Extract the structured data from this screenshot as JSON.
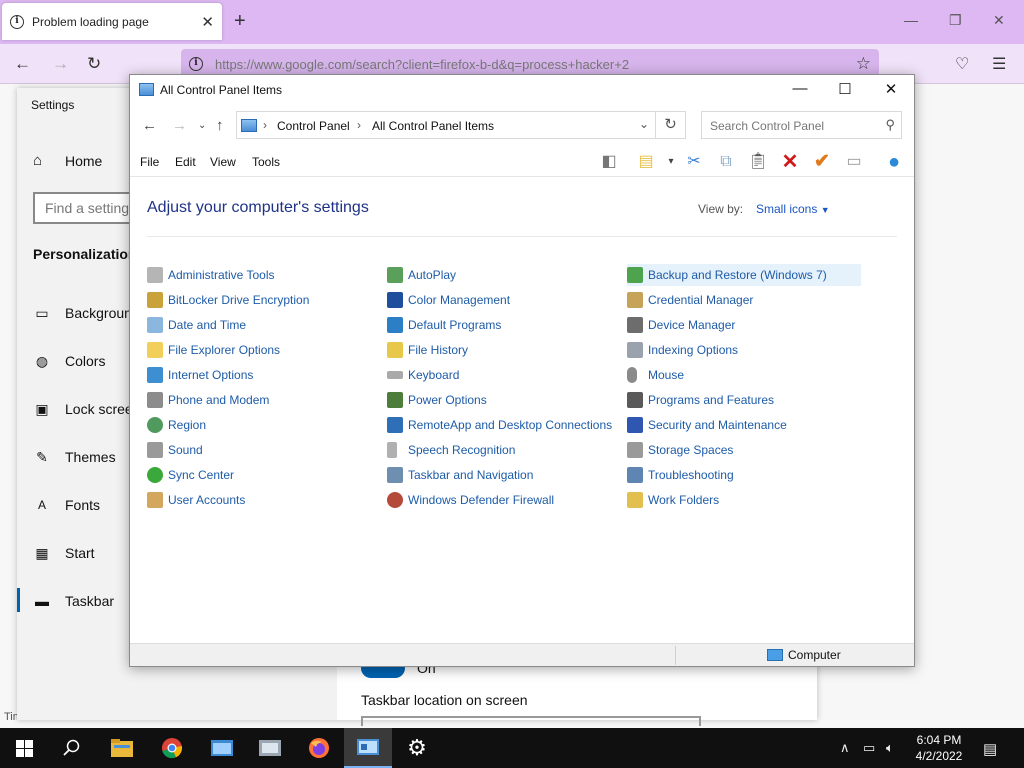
{
  "browser": {
    "tab_title": "Problem loading page",
    "url": "https://www.google.com/search?client=firefox-b-d&q=process+hacker+2",
    "page_status": "Timed Out"
  },
  "settings": {
    "title": "Settings",
    "home": "Home",
    "find_placeholder": "Find a setting",
    "section": "Personalization",
    "nav": [
      "Background",
      "Colors",
      "Lock screen",
      "Themes",
      "Fonts",
      "Start",
      "Taskbar"
    ],
    "active_nav": "Taskbar",
    "toggle_state": "On",
    "location_label": "Taskbar location on screen"
  },
  "control_panel": {
    "title": "All Control Panel Items",
    "breadcrumb": [
      "Control Panel",
      "All Control Panel Items"
    ],
    "search_placeholder": "Search Control Panel",
    "menu": [
      "File",
      "Edit",
      "View",
      "Tools"
    ],
    "heading": "Adjust your computer's settings",
    "view_by_label": "View by:",
    "view_by_value": "Small icons",
    "columns": [
      [
        "Administrative Tools",
        "BitLocker Drive Encryption",
        "Date and Time",
        "File Explorer Options",
        "Internet Options",
        "Phone and Modem",
        "Region",
        "Sound",
        "Sync Center",
        "User Accounts"
      ],
      [
        "AutoPlay",
        "Color Management",
        "Default Programs",
        "File History",
        "Keyboard",
        "Power Options",
        "RemoteApp and Desktop Connections",
        "Speech Recognition",
        "Taskbar and Navigation",
        "Windows Defender Firewall"
      ],
      [
        "Backup and Restore (Windows 7)",
        "Credential Manager",
        "Device Manager",
        "Indexing Options",
        "Mouse",
        "Programs and Features",
        "Security and Maintenance",
        "Storage Spaces",
        "Troubleshooting",
        "Work Folders"
      ]
    ],
    "highlighted_item": "Backup and Restore (Windows 7)",
    "status_location": "Computer"
  },
  "taskbar": {
    "time": "6:04 PM",
    "date": "4/2/2022"
  },
  "colors": {
    "firefox_tabbar": "#ddb8f2",
    "firefox_toolbar": "#f0e2f8",
    "link_blue": "#1e5ca8",
    "heading_blue": "#1e3287",
    "taskbar": "#101010"
  }
}
